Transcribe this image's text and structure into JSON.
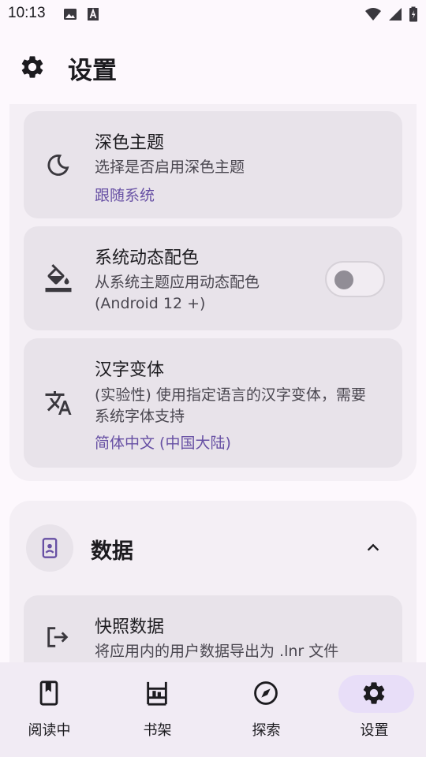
{
  "status_bar": {
    "time": "10:13",
    "left_icons": [
      "image-icon",
      "font-a-icon"
    ],
    "right_icons": [
      "wifi-icon",
      "signal-icon",
      "battery-icon"
    ]
  },
  "header": {
    "title": "设置",
    "icon": "gear-icon"
  },
  "appearance": {
    "dark_theme": {
      "title": "深色主题",
      "description": "选择是否启用深色主题",
      "value": "跟随系统",
      "icon": "moon-icon"
    },
    "dynamic_color": {
      "title": "系统动态配色",
      "description": "从系统主题应用动态配色 (Android 12 +)",
      "icon": "paint-bucket-icon",
      "enabled": false
    },
    "han_variant": {
      "title": "汉字变体",
      "description": "(实验性) 使用指定语言的汉字变体，需要系统字体支持",
      "value": "简体中文 (中国大陆)",
      "icon": "translate-icon"
    }
  },
  "data_section": {
    "title": "数据",
    "icon": "contact-book-icon",
    "expanded": true,
    "snapshot": {
      "title": "快照数据",
      "description": "将应用内的用户数据导出为 .lnr 文件",
      "icon": "export-icon"
    }
  },
  "bottom_nav": {
    "items": [
      {
        "label": "阅读中",
        "icon": "bookmark-book-icon",
        "active": false
      },
      {
        "label": "书架",
        "icon": "bookshelf-icon",
        "active": false
      },
      {
        "label": "探索",
        "icon": "compass-icon",
        "active": false
      },
      {
        "label": "设置",
        "icon": "gear-icon",
        "active": true
      }
    ]
  },
  "colors": {
    "accent": "#6750a4",
    "background": "#fdf8fd",
    "card": "#e8e3ea",
    "active_pill": "#e8def8"
  }
}
